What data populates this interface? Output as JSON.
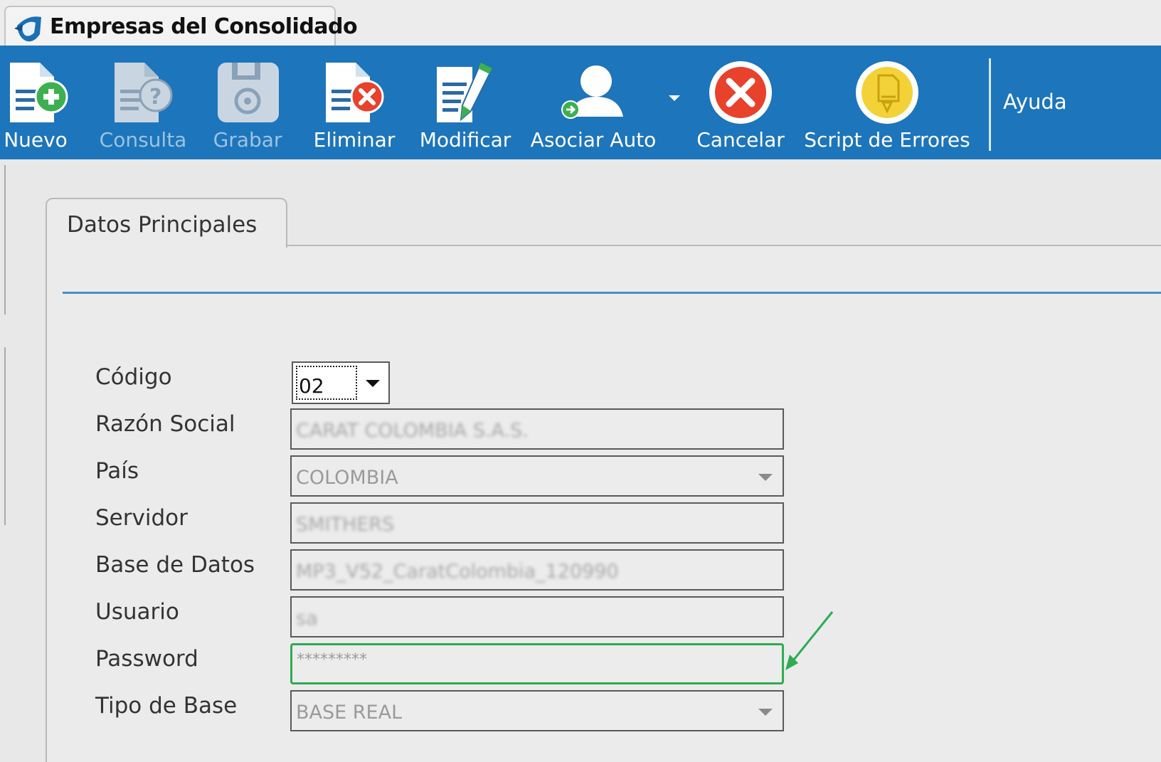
{
  "window": {
    "title": "Empresas del Consolidado"
  },
  "toolbar": {
    "buttons": [
      {
        "label": "Nuevo",
        "icon": "new-document-icon",
        "enabled": true
      },
      {
        "label": "Consulta",
        "icon": "query-document-icon",
        "enabled": false
      },
      {
        "label": "Grabar",
        "icon": "save-icon",
        "enabled": false
      },
      {
        "label": "Eliminar",
        "icon": "delete-document-icon",
        "enabled": true
      },
      {
        "label": "Modificar",
        "icon": "edit-document-icon",
        "enabled": true
      },
      {
        "label": "Asociar Auto",
        "icon": "associate-user-icon",
        "enabled": true
      },
      {
        "label": "Cancelar",
        "icon": "cancel-icon",
        "enabled": true
      },
      {
        "label": "Script de Errores",
        "icon": "error-script-icon",
        "enabled": true
      }
    ],
    "help_label": "Ayuda",
    "colors": {
      "background": "#1d75bb",
      "label": "#ffffff",
      "disabled_label": "#9cc3e4"
    }
  },
  "tabs": {
    "active_label": "Datos Principales"
  },
  "form": {
    "codigo": {
      "label": "Código",
      "value": "02"
    },
    "razon_social": {
      "label": "Razón Social",
      "value": "CARAT COLOMBIA S.A.S."
    },
    "pais": {
      "label": "País",
      "value": "COLOMBIA"
    },
    "servidor": {
      "label": "Servidor",
      "value": "SMITHERS"
    },
    "base_datos": {
      "label": "Base de Datos",
      "value": "MP3_V52_CaratColombia_120990"
    },
    "usuario": {
      "label": "Usuario",
      "value": "sa"
    },
    "password": {
      "label": "Password",
      "value": "*********"
    },
    "tipo_base": {
      "label": "Tipo de Base",
      "value": "BASE REAL"
    }
  },
  "annotation": {
    "highlight_color": "#2eab53"
  }
}
